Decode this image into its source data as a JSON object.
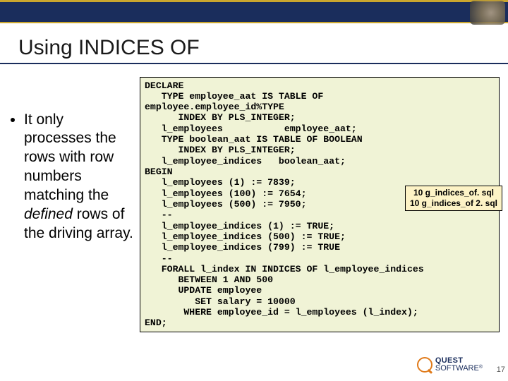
{
  "title": "Using INDICES OF",
  "bullet": {
    "text_pre": "It only processes the rows with row numbers matching the ",
    "em": "defined",
    "text_post": " rows of the driving array."
  },
  "code": "DECLARE\n   TYPE employee_aat IS TABLE OF\nemployee.employee_id%TYPE\n      INDEX BY PLS_INTEGER;\n   l_employees           employee_aat;\n   TYPE boolean_aat IS TABLE OF BOOLEAN\n      INDEX BY PLS_INTEGER;\n   l_employee_indices   boolean_aat;\nBEGIN\n   l_employees (1) := 7839;\n   l_employees (100) := 7654;\n   l_employees (500) := 7950;\n   --\n   l_employee_indices (1) := TRUE;\n   l_employee_indices (500) := TRUE;\n   l_employee_indices (799) := TRUE\n   --\n   FORALL l_index IN INDICES OF l_employee_indices\n      BETWEEN 1 AND 500\n      UPDATE employee\n         SET salary = 10000\n       WHERE employee_id = l_employees (l_index);\nEND;",
  "callout": {
    "line1": "10 g_indices_of. sql",
    "line2": "10 g_indices_of 2. sql"
  },
  "logo": {
    "brand1": "QUEST",
    "brand2": "SOFTWARE"
  },
  "pagenum": "17"
}
